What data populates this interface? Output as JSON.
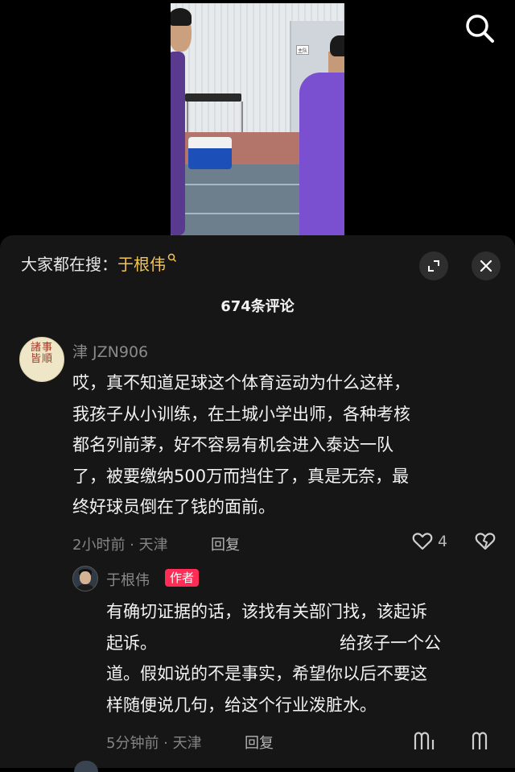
{
  "video": {
    "door_sign": "主队"
  },
  "top_bar": {
    "search_icon": "search-icon"
  },
  "panel": {
    "hot_search_prefix": "大家都在搜：",
    "hot_search_keyword": "于根伟",
    "hot_search_keyword_icon": "search-small-icon",
    "expand_icon": "expand-icon",
    "close_icon": "close-icon",
    "comment_count_label": "674条评论"
  },
  "comment": {
    "avatar_text": "諸事皆順",
    "username": "津 JZN906",
    "lines": [
      "哎，真不知道足球这个体育运动为什么这样，",
      "我孩子从小训练，在土城小学出师，各种考核",
      "都名列前茅，好不容易有机会进入泰达一队",
      "了，被要缴纳500万而挡住了，真是无奈，最",
      "终好球员倒在了钱的面前。"
    ],
    "time_location": "2小时前 · 天津",
    "reply_label": "回复",
    "like_count": "4",
    "like_icon": "heart-icon",
    "dislike_icon": "broken-heart-icon"
  },
  "reply": {
    "username": "于根伟",
    "badge": "作者",
    "lines": [
      "有确切证据的话，该找有关部门找，该起诉",
      "起诉。                                  给孩子一个公",
      "道。假如说的不是事实，希望你以后不要这",
      "样随便说几句，给这个行业泼脏水。"
    ],
    "time_location": "5分钟前 · 天津",
    "reply_label": "回复"
  },
  "colors": {
    "panel_bg": "#161616",
    "keyword": "#f3c653",
    "author_badge": "#ff2d55"
  }
}
